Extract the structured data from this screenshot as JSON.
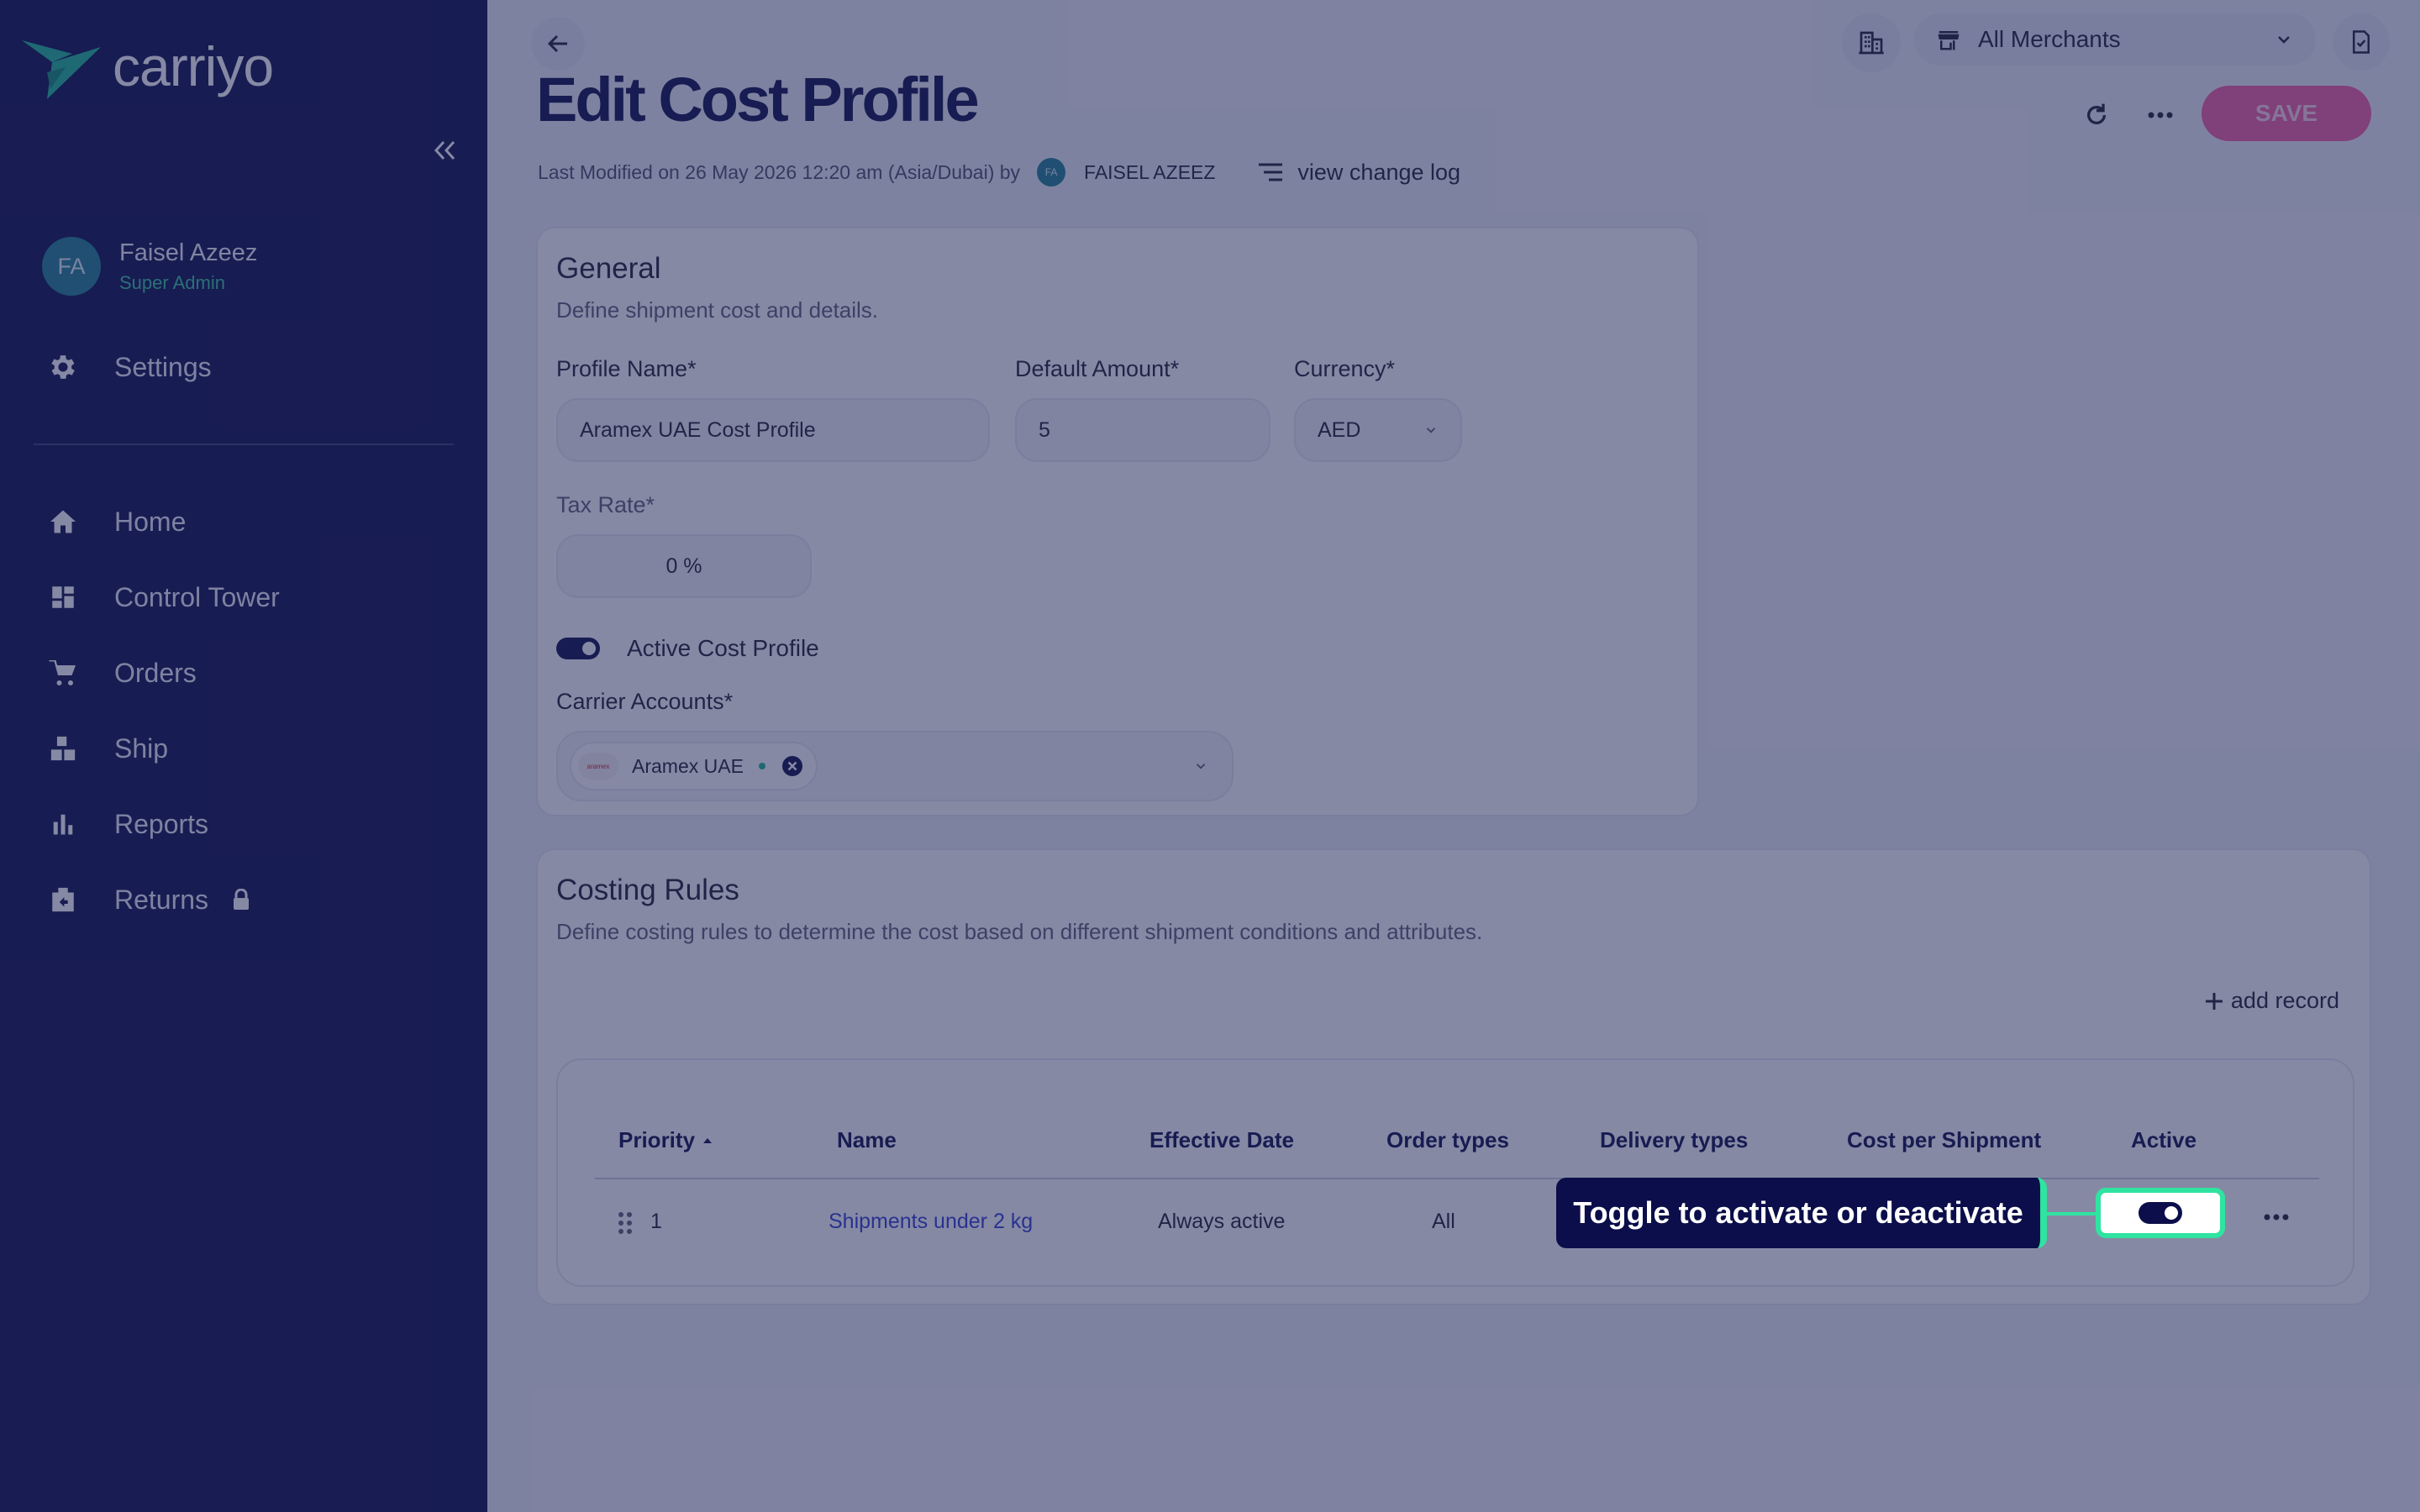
{
  "brand": {
    "name": "carriyo",
    "accent": "#2fe3a0",
    "logo_color": "#19b894"
  },
  "sidebar": {
    "collapse_icon": "double-chevron-left-icon",
    "user": {
      "initials": "FA",
      "name": "Faisel Azeez",
      "role": "Super Admin"
    },
    "settings_label": "Settings",
    "items": [
      {
        "label": "Home",
        "icon": "home-icon"
      },
      {
        "label": "Control Tower",
        "icon": "dashboard-icon"
      },
      {
        "label": "Orders",
        "icon": "cart-icon"
      },
      {
        "label": "Ship",
        "icon": "boxes-icon"
      },
      {
        "label": "Reports",
        "icon": "bar-chart-icon"
      },
      {
        "label": "Returns",
        "icon": "return-box-icon",
        "locked": true
      }
    ]
  },
  "header": {
    "merchant_select": "All Merchants",
    "title": "Edit Cost Profile",
    "meta": {
      "text": "Last Modified on 26 May 2026 12:20 am (Asia/Dubai) by",
      "user_initials": "FA",
      "user": "FAISEL AZEEZ",
      "changelog": "view change log"
    },
    "save_label": "SAVE"
  },
  "general": {
    "title": "General",
    "subtitle": "Define shipment cost and details.",
    "profile_name_label": "Profile Name*",
    "profile_name_value": "Aramex UAE Cost Profile",
    "default_amount_label": "Default Amount*",
    "default_amount_value": "5",
    "currency_label": "Currency*",
    "currency_value": "AED",
    "tax_rate_label": "Tax Rate*",
    "tax_rate_value": "0 %",
    "active_label": "Active Cost Profile",
    "active": true,
    "carrier_label": "Carrier Accounts*",
    "carrier_chip": "Aramex UAE",
    "carrier_logo_text": "aramex"
  },
  "costing": {
    "title": "Costing Rules",
    "subtitle": "Define costing rules to determine the cost based on different shipment conditions and attributes.",
    "add_record": "add record",
    "columns": [
      "Priority",
      "Name",
      "Effective Date",
      "Order types",
      "Delivery types",
      "Cost per Shipment",
      "Active"
    ],
    "rows": [
      {
        "priority": "1",
        "name": "Shipments under 2 kg",
        "effective_date": "Always active",
        "order_types": "All",
        "active": true
      }
    ]
  },
  "tooltip": {
    "text": "Toggle to activate or deactivate"
  }
}
